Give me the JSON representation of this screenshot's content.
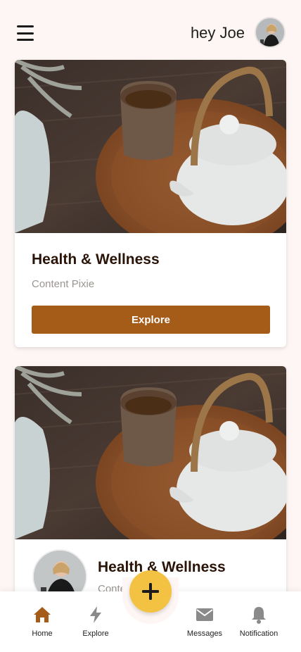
{
  "header": {
    "greeting": "hey Joe"
  },
  "cards": [
    {
      "title": "Health & Wellness",
      "subtitle": "Content Pixie",
      "button_label": "Explore"
    },
    {
      "title": "Health & Wellness",
      "subtitle": "Content Pixie"
    }
  ],
  "nav": {
    "items": [
      {
        "label": "Home",
        "icon": "home-icon",
        "active": true
      },
      {
        "label": "Explore",
        "icon": "lightning-icon",
        "active": false
      },
      {
        "label": "Messages",
        "icon": "envelope-icon",
        "active": false
      },
      {
        "label": "Notification",
        "icon": "bell-icon",
        "active": false
      }
    ],
    "fab_icon": "plus-icon"
  },
  "colors": {
    "background": "#fdf6f4",
    "accent_brown": "#a65c19",
    "fab_yellow": "#f4c242",
    "inactive_icon": "#8a8a8a"
  }
}
